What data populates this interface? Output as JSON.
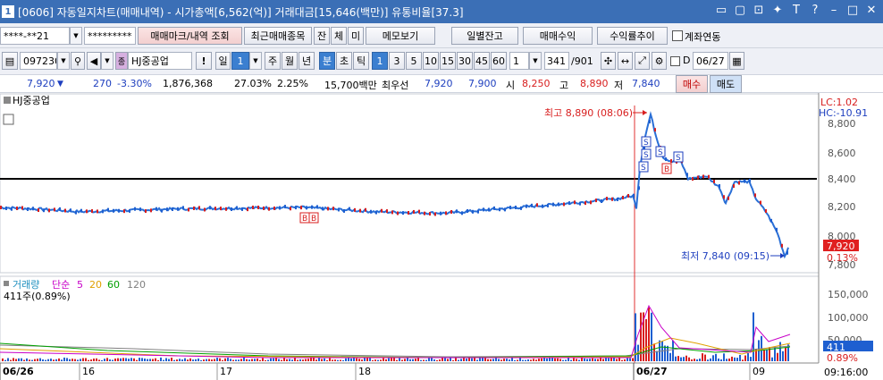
{
  "window": {
    "icon_label": "1",
    "title": "[0606] 자동일지차트(매매내역) - 시가총액[6,562(억)] 거래대금[15,646(백만)] 유통비율[37.3]",
    "title_buttons": [
      "▭",
      "▢",
      "⊡",
      "✦",
      "T",
      "?",
      "–",
      "□",
      "✕"
    ]
  },
  "toolbar1": {
    "account": "****-**21",
    "password": "*********",
    "trade_mark_btn": "매매마크/내역 조회",
    "recent_btn": "최근매매종목",
    "jan_btn": "잔",
    "che_btn": "체",
    "mi_btn": "미",
    "memo_btn": "메모보기",
    "daily_balance_btn": "일별잔고",
    "trade_profit_btn": "매매수익",
    "profit_rate_btn": "수익률추이",
    "linked_account_label": "계좌연동"
  },
  "toolbar2": {
    "code": "097230",
    "stock_name": "HJ중공업",
    "warning_btn": "!",
    "period_label": "일",
    "period_value": "1",
    "periods": [
      "주",
      "월",
      "년",
      "분",
      "초",
      "틱"
    ],
    "intervals": [
      "1",
      "3",
      "5",
      "10",
      "15",
      "30",
      "45",
      "60"
    ],
    "custom_interval": "1",
    "count": "341",
    "count_total": "/901",
    "d_label": "D",
    "date": "06/27"
  },
  "quote": {
    "price": "7,920",
    "change": "270",
    "change_pct": "-3.30%",
    "volume": "1,876,368",
    "vol_ratio": "27.03%",
    "turnover": "2.25%",
    "amount": "15,700백만",
    "best_label": "최우선",
    "best_bid": "7,920",
    "best_ask": "7,900",
    "open_label": "시",
    "open": "8,250",
    "high_label": "고",
    "high": "8,890",
    "low_label": "저",
    "low": "7,840",
    "buy_btn": "매수",
    "sell_btn": "매도"
  },
  "price_panel": {
    "stock_label": "HJ중공업",
    "lc": "LC:1.02",
    "hc": "HC:-10.91",
    "y_ticks": [
      "8,800",
      "8,600",
      "8,400",
      "8,200",
      "8,000",
      "7,800"
    ],
    "current_price_label": "7,920",
    "current_pct_label": "0.13%",
    "high_annotation": "최고 8,890 (08:06)",
    "low_annotation": "최저 7,840 (09:15)",
    "markers": [
      "S",
      "S",
      "S",
      "S",
      "B",
      "S",
      "B",
      "B"
    ],
    "reference_line": 8400
  },
  "volume_panel": {
    "title": "거래량",
    "ma_label": "단순",
    "ma_periods": [
      "5",
      "20",
      "60",
      "120"
    ],
    "info": "411주(0.89%)",
    "y_ticks": [
      "150,000",
      "100,000",
      "50,000"
    ],
    "current_vol_label": "411",
    "current_vol_pct": "0.89%"
  },
  "x_axis": {
    "labels": [
      "06/26",
      "16",
      "17",
      "18",
      "06/27",
      "09"
    ],
    "time_label": "09:16:00"
  },
  "colors": {
    "title_bar": "#3b6fb6",
    "up": "#d81e1e",
    "down": "#1e5fd0",
    "reference_line": "#000000",
    "ma5": "#c800c8",
    "ma20": "#e0a000",
    "ma60": "#00a000",
    "ma120": "#808080"
  }
}
